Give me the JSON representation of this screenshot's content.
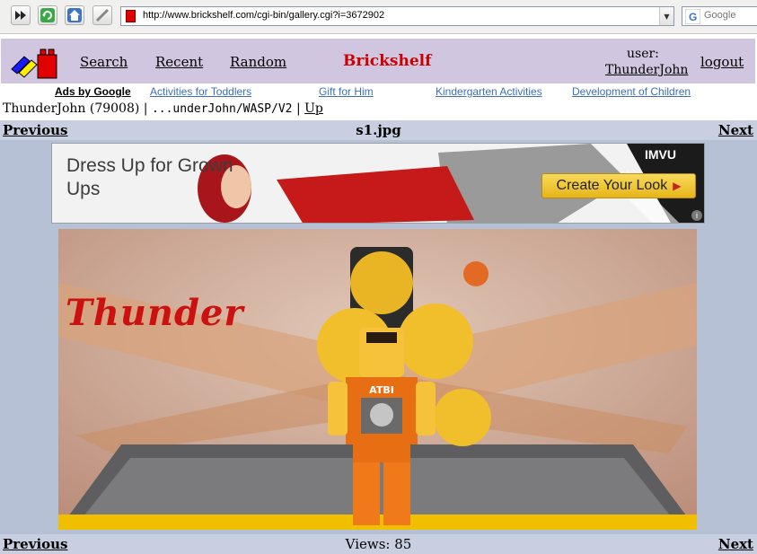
{
  "browser": {
    "url": "http://www.brickshelf.com/cgi-bin/gallery.cgi?i=3672902",
    "search_placeholder": "Google"
  },
  "header": {
    "brand": "Brickshelf",
    "nav": {
      "search": "Search",
      "recent": "Recent",
      "random": "Random"
    },
    "user_label": "user:",
    "user_name": "ThunderJohn",
    "logout": "logout"
  },
  "ads_row": {
    "label": "Ads by Google",
    "links": [
      "Activities for Toddlers",
      "Gift for Him",
      "Kindergarten Activities",
      "Development of Children"
    ]
  },
  "breadcrumb": {
    "owner": "ThunderJohn (79008)",
    "sep": "|",
    "path": "...underJohn/WASP/V2",
    "up": "Up"
  },
  "gallery": {
    "previous": "Previous",
    "next": "Next",
    "file_name": "s1.jpg",
    "views_text": "Views: 85"
  },
  "banner": {
    "headline": "Dress Up for Grown Ups",
    "cta": "Create Your Look",
    "brand": "IMVU",
    "info": "i"
  },
  "photo": {
    "caption": "Thunder",
    "torso_print": "ATBI"
  },
  "colors": {
    "header_bg": "#d0c6e0",
    "brand": "#cc0000",
    "ad_link": "#3d6fb8",
    "bar_bg": "#c7cfe0",
    "gallery_bg": "#b7c1d6"
  }
}
